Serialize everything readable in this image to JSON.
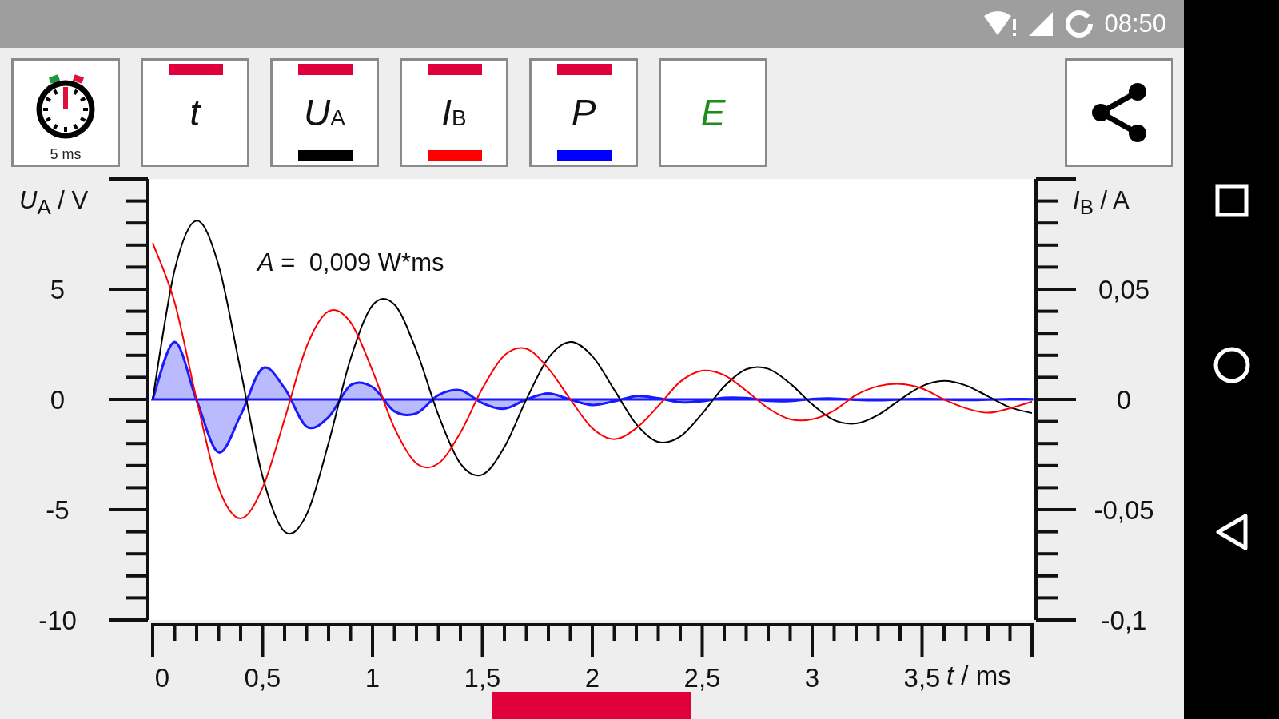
{
  "status_bar": {
    "time": "08:50"
  },
  "toolbar": {
    "buttons": [
      {
        "kind": "timer",
        "label": "5 ms",
        "selected": false
      },
      {
        "kind": "quantity",
        "symbol": "t",
        "selected": true
      },
      {
        "kind": "quantity",
        "symbol": "U",
        "subscript": "A",
        "selected": true,
        "color": "#000000"
      },
      {
        "kind": "quantity",
        "symbol": "I",
        "subscript": "B",
        "selected": true,
        "color": "#ff0000"
      },
      {
        "kind": "quantity",
        "symbol": "P",
        "selected": true,
        "color": "#0000ff"
      },
      {
        "kind": "energy",
        "symbol": "E",
        "selected": false
      }
    ]
  },
  "chart": {
    "chart_data": {
      "type": "line",
      "xlabel": "*t* / ms",
      "ylabel": "*U*$_{A}$ / V",
      "y2label": "*I*$_{B}$ / A",
      "xlim": [
        0,
        4
      ],
      "ylim": [
        -10,
        10
      ],
      "y2lim": [
        -0.1,
        0.1
      ],
      "xticks": [
        {
          "value": 0,
          "label": "0"
        },
        {
          "value": 0.5,
          "label": "0,5"
        },
        {
          "value": 1,
          "label": "1"
        },
        {
          "value": 1.5,
          "label": "1,5"
        },
        {
          "value": 2,
          "label": "2"
        },
        {
          "value": 2.5,
          "label": "2,5"
        },
        {
          "value": 3,
          "label": "3"
        },
        {
          "value": 3.5,
          "label": "3,5"
        }
      ],
      "yticks": [
        {
          "value": 5,
          "label": "5"
        },
        {
          "value": 0,
          "label": "0"
        },
        {
          "value": -5,
          "label": "-5"
        },
        {
          "value": -10,
          "label": "-10"
        }
      ],
      "y2ticks": [
        {
          "value": 0.05,
          "label": "0,05"
        },
        {
          "value": 0,
          "label": "0"
        },
        {
          "value": -0.05,
          "label": "-0,05"
        },
        {
          "value": -0.1,
          "label": "-0,1"
        }
      ],
      "x": [
        0,
        0.1,
        0.2,
        0.3,
        0.4,
        0.5,
        0.6,
        0.7,
        0.8,
        0.9,
        1,
        1.1,
        1.2,
        1.3,
        1.4,
        1.5,
        1.6,
        1.7,
        1.8,
        1.9,
        2,
        2.1,
        2.2,
        2.3,
        2.4,
        2.5,
        2.6,
        2.7,
        2.8,
        2.9,
        3,
        3.1,
        3.2,
        3.3,
        3.4,
        3.5,
        3.6,
        3.7,
        3.8,
        3.9,
        4
      ],
      "series": [
        {
          "type": "line",
          "color": "#000000",
          "values": [
            0,
            5.87,
            8.11,
            6.08,
            1.32,
            -3.5,
            -6,
            -5.22,
            -1.98,
            1.84,
            4.27,
            4.3,
            2.21,
            -0.71,
            -2.91,
            -3.41,
            -2.16,
            0,
            1.88,
            2.61,
            1.96,
            0.43,
            -1.12,
            -1.93,
            -1.68,
            -0.64,
            0.59,
            1.37,
            1.39,
            0.72,
            -0.22,
            -0.94,
            -1.09,
            -0.7,
            -0.01,
            0.6,
            0.84,
            0.63,
            0.14,
            -0.36,
            -0.62
          ]
        },
        {
          "type": "line",
          "axis": "y2",
          "color": "#ff0000",
          "values": [
            0.071,
            0.044,
            0,
            -0.04,
            -0.054,
            -0.04,
            -0.009,
            0.024,
            0.04,
            0.035,
            0.013,
            -0.013,
            -0.029,
            -0.029,
            -0.015,
            0.005,
            0.02,
            0.023,
            0.014,
            0,
            -0.013,
            -0.018,
            -0.013,
            -0.003,
            0.008,
            0.013,
            0.011,
            0.004,
            -0.004,
            -0.009,
            -0.009,
            -0.005,
            0.002,
            0.006,
            0.007,
            0.005,
            0,
            -0.004,
            -0.006,
            -0.004,
            -0.001
          ]
        },
        {
          "type": "area",
          "color": "#1a1aff",
          "values": [
            0,
            2.61,
            -0.04,
            -2.4,
            -0.72,
            1.41,
            0.51,
            -1.23,
            -0.8,
            0.64,
            0.56,
            -0.54,
            -0.63,
            0.2,
            0.42,
            -0.17,
            -0.42,
            0,
            0.27,
            -0.01,
            -0.25,
            -0.08,
            0.15,
            0.05,
            -0.13,
            -0.08,
            0.07,
            0.06,
            -0.06,
            -0.07,
            0.02,
            0.04,
            -0.02,
            -0.04,
            0,
            0.03,
            0,
            -0.03,
            -0.01,
            0.02,
            0.01
          ]
        }
      ],
      "annotations": [
        {
          "text": "*A* =  0,009 W*ms"
        }
      ]
    }
  }
}
